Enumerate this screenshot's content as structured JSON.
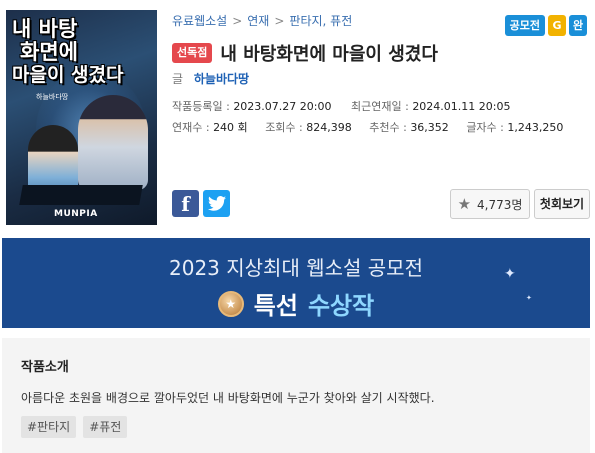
{
  "cover": {
    "title_line1": "내 바탕",
    "title_line2": "화면에",
    "title_line3": "마을이 생겼다",
    "author_small": "하늘바다땅",
    "publisher_logo": "MUNPIA"
  },
  "breadcrumb": [
    "유료웹소설",
    "연재",
    "판타지, 퓨전"
  ],
  "badges": {
    "contest": "공모전",
    "grade": "G",
    "complete": "완"
  },
  "exclusive_label": "선독점",
  "title": "내 바탕화면에 마을이 생겼다",
  "author": {
    "label": "글",
    "name": "하늘바다땅"
  },
  "dates": {
    "registered_label": "작품등록일 :",
    "registered": "2023.07.27 20:00",
    "latest_label": "최근연재일 :",
    "latest": "2024.01.11 20:05"
  },
  "stats": {
    "episodes_label": "연재수 :",
    "episodes": "240 회",
    "views_label": "조회수 :",
    "views": "824,398",
    "recs_label": "추천수 :",
    "recs": "36,352",
    "chars_label": "글자수 :",
    "chars": "1,243,250"
  },
  "share": {
    "facebook_glyph": "f",
    "twitter_icon": "twitter-bird"
  },
  "buttons": {
    "recommend_count": "4,773명",
    "first_episode": "첫회보기"
  },
  "banner": {
    "line1": "2023 지상최대 웹소설 공모전",
    "prize_a": "특선",
    "prize_b": "수상작"
  },
  "intro": {
    "heading": "작품소개",
    "text": "아름다운 초원을 배경으로 깔아두었던 내 바탕화면에 누군가 찾아와 살기 시작했다.",
    "tags": [
      "#판타지",
      "#퓨전"
    ]
  },
  "colors": {
    "banner_bg": "#1b4a8e",
    "exclusive": "#e5484d",
    "contest_badge": "#1a8fd8",
    "grade_badge": "#f2b200"
  }
}
